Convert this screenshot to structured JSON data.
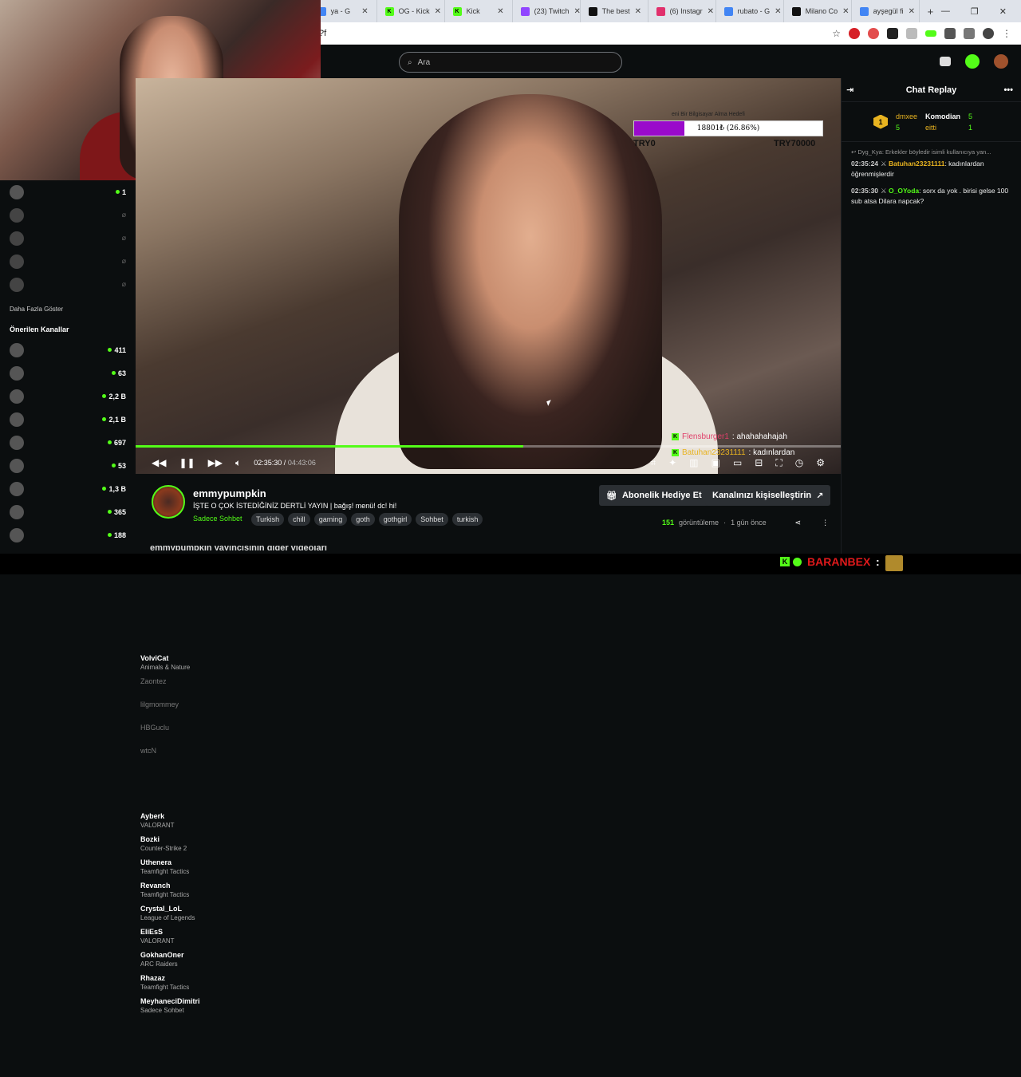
{
  "browser": {
    "tabs": [
      {
        "label": "ya - G",
        "fav": "google",
        "color": "#4285f4"
      },
      {
        "label": "OG - Kick",
        "fav": "kick",
        "color": "#53fc18"
      },
      {
        "label": "Kick",
        "fav": "kick",
        "color": "#53fc18"
      },
      {
        "label": "(23) Twitch",
        "fav": "twitch",
        "color": "#9146ff"
      },
      {
        "label": "The best",
        "fav": "nyt",
        "color": "#111111"
      },
      {
        "label": "(6) Instagr",
        "fav": "instagram",
        "color": "#e1306c"
      },
      {
        "label": "rubato - G",
        "fav": "google",
        "color": "#4285f4"
      },
      {
        "label": "Milano Co",
        "fav": "app",
        "color": "#111111"
      },
      {
        "label": "ayşegül fi",
        "fav": "google",
        "color": "#4285f4"
      }
    ],
    "url_fragment": "?f"
  },
  "topnav": {
    "search_placeholder": "Ara"
  },
  "sidebar": {
    "following": [
      {
        "name": "VolviCat",
        "game": "Animals & Nature",
        "viewers": "1",
        "live": true
      },
      {
        "name": "Zaontez",
        "game": "",
        "viewers": "",
        "live": false
      },
      {
        "name": "lilgmommey",
        "game": "",
        "viewers": "",
        "live": false
      },
      {
        "name": "HBGuclu",
        "game": "",
        "viewers": "",
        "live": false
      },
      {
        "name": "wtcN",
        "game": "",
        "viewers": "",
        "live": false
      }
    ],
    "show_more": "Daha Fazla Göster",
    "recommended_title": "Önerilen Kanallar",
    "recommended": [
      {
        "name": "Ayberk",
        "game": "VALORANT",
        "viewers": "411"
      },
      {
        "name": "Bozki",
        "game": "Counter-Strike 2",
        "viewers": "63"
      },
      {
        "name": "Uthenera",
        "game": "Teamfight Tactics",
        "viewers": "2,2 B"
      },
      {
        "name": "Revanch",
        "game": "Teamfight Tactics",
        "viewers": "2,1 B"
      },
      {
        "name": "Crystal_LoL",
        "game": "League of Legends",
        "viewers": "697"
      },
      {
        "name": "EliEsS",
        "game": "VALORANT",
        "viewers": "53"
      },
      {
        "name": "GokhanOner",
        "game": "ARC Raiders",
        "viewers": "1,3 B"
      },
      {
        "name": "Rhazaz",
        "game": "Teamfight Tactics",
        "viewers": "365"
      },
      {
        "name": "MeyhaneciDimitri",
        "game": "Sadece Sohbet",
        "viewers": "188"
      }
    ]
  },
  "video": {
    "goal_head": "eni Bir Bilgisayar Alma Hedefi",
    "goal_text": "18801₺ (26.86%)",
    "goal_progress": 0.2686,
    "goal_min": "TRY0",
    "goal_max": "TRY70000",
    "overlay_msgs": [
      {
        "user": "Flensburger1",
        "text": ": ahahahahajah"
      },
      {
        "user": "Batuhan23231111",
        "text": ": kadınlardan"
      }
    ],
    "current_time": "02:35:30",
    "duration": "04:43:06",
    "played_fraction": 0.55
  },
  "channel": {
    "name": "emmypumpkin",
    "title": "İŞTE O ÇOK İSTEDİĞİNİZ DERTLİ YAYIN | bağış! menü! dc! hi!",
    "category": "Sadece Sohbet",
    "tags": [
      "Turkish",
      "chill",
      "gaming",
      "goth",
      "gothgirl",
      "Sohbet",
      "turkish"
    ],
    "gift_button": "Abonelik Hediye Et",
    "customize_button": "Kanalınızı kişiselleştirin",
    "views_count": "151",
    "views_label": "görüntüleme",
    "ago": "1 gün önce",
    "more_videos": "emmypumpkin yayıncısının diğer videoları"
  },
  "chat": {
    "title": "Chat Replay",
    "gifters": [
      {
        "name": "dmxee",
        "count": "5"
      },
      {
        "name": "Komodian",
        "count": "5"
      },
      {
        "name": "eitti",
        "count": "1"
      }
    ],
    "reply_to": "Dyg_Kya: Erkekler böyledir isimli kullanıcıya yan...",
    "messages": [
      {
        "time": "02:35:24",
        "user": "Batuhan23231111",
        "text": "kadınlardan öğrenmişlerdir",
        "color": "gold"
      },
      {
        "time": "02:35:30",
        "user": "O_OYoda",
        "text": "sorx da yok . birisi gelse 100 sub atsa Dilara napcak?",
        "color": "green"
      }
    ]
  },
  "bottom_user": {
    "name": "BARANBEX",
    "sep": ":"
  }
}
